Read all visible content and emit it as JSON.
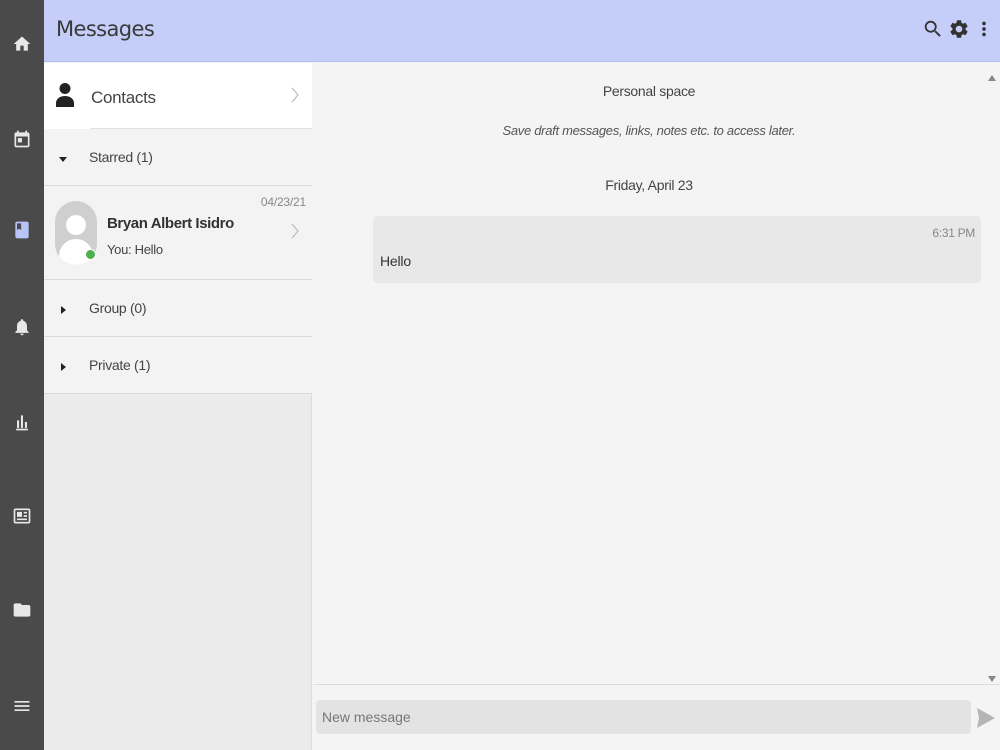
{
  "header": {
    "title": "Messages",
    "search_icon": "search-icon",
    "settings_icon": "gear-icon",
    "more_icon": "more-vert-icon",
    "background": "#c5cef9"
  },
  "rail": {
    "items": [
      {
        "icon": "home-icon"
      },
      {
        "icon": "calendar-icon"
      },
      {
        "icon": "messages-icon",
        "active": true
      },
      {
        "icon": "bell-icon"
      },
      {
        "icon": "bar-chart-icon"
      },
      {
        "icon": "news-icon"
      },
      {
        "icon": "folder-icon"
      },
      {
        "icon": "menu-icon"
      }
    ],
    "background": "#4a4a4a"
  },
  "contacts": {
    "label": "Contacts"
  },
  "sections": {
    "starred": {
      "title": "Starred (1)",
      "expanded": true
    },
    "group": {
      "title": "Group (0)",
      "expanded": false
    },
    "private": {
      "title": "Private (1)",
      "expanded": false
    }
  },
  "chat_list": [
    {
      "name": "Bryan Albert Isidro",
      "preview": "You: Hello",
      "date": "04/23/21",
      "online": true
    }
  ],
  "conversation": {
    "title": "Personal space",
    "subtitle": "Save draft messages, links, notes etc. to access later.",
    "date_separator": "Friday, April 23",
    "messages": [
      {
        "time": "6:31 PM",
        "text": "Hello"
      }
    ]
  },
  "composer": {
    "placeholder": "New message",
    "value": ""
  }
}
